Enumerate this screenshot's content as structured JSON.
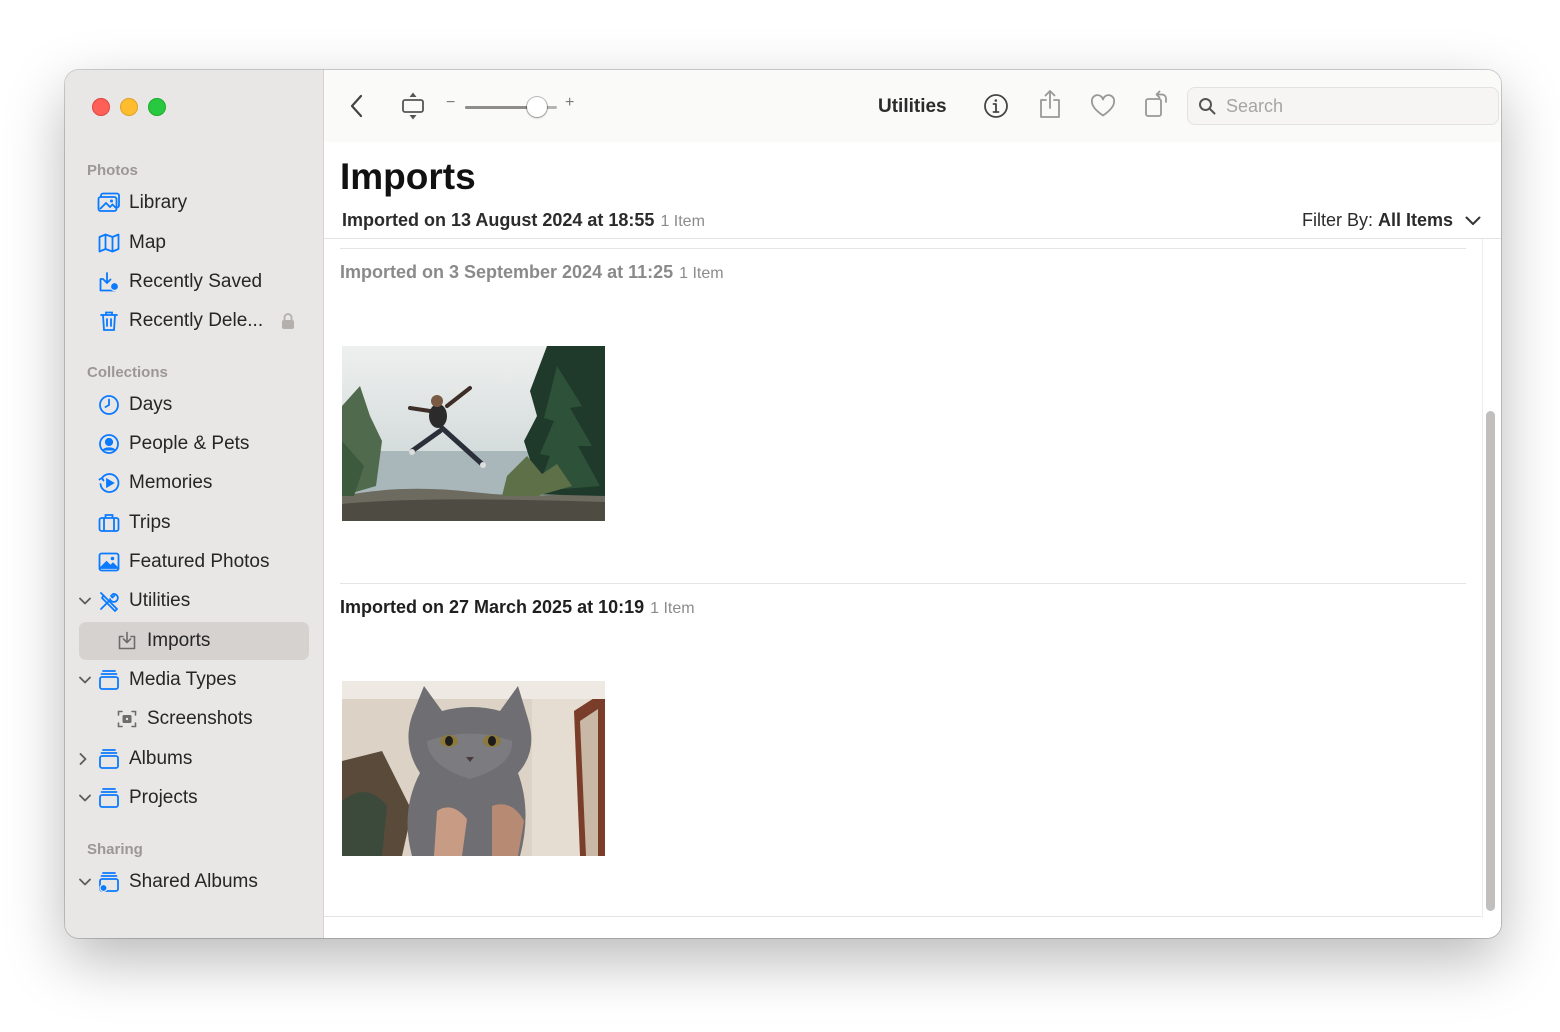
{
  "sidebar": {
    "sections": {
      "photos": "Photos",
      "collections": "Collections",
      "sharing": "Sharing"
    },
    "items": {
      "library": "Library",
      "map": "Map",
      "recently_saved": "Recently Saved",
      "recently_deleted": "Recently Dele...",
      "days": "Days",
      "people_pets": "People & Pets",
      "memories": "Memories",
      "trips": "Trips",
      "featured_photos": "Featured Photos",
      "utilities": "Utilities",
      "imports": "Imports",
      "media_types": "Media Types",
      "screenshots": "Screenshots",
      "albums": "Albums",
      "projects": "Projects",
      "shared_albums": "Shared Albums"
    },
    "selected": "imports"
  },
  "toolbar": {
    "title": "Utilities",
    "zoom_minus": "−",
    "zoom_plus": "+",
    "zoom_level": 0.78,
    "search_placeholder": "Search"
  },
  "main": {
    "page_title": "Imports",
    "header": {
      "label": "Imported on 13 August 2024 at 18:55",
      "count": "1 Item"
    },
    "filter": {
      "label": "Filter By:",
      "value": "All Items"
    },
    "groups": [
      {
        "label": "Imported on 3 September 2024 at 11:25",
        "count": "1 Item",
        "photo": "person-jumping-by-lake"
      },
      {
        "label": "Imported on 27 March 2025 at 10:19",
        "count": "1 Item",
        "photo": "grey-cat-held-up"
      }
    ]
  },
  "colors": {
    "accent": "#0a7aff",
    "sidebar_bg": "#e9e7e6",
    "selected_bg": "#d5d2d0"
  }
}
